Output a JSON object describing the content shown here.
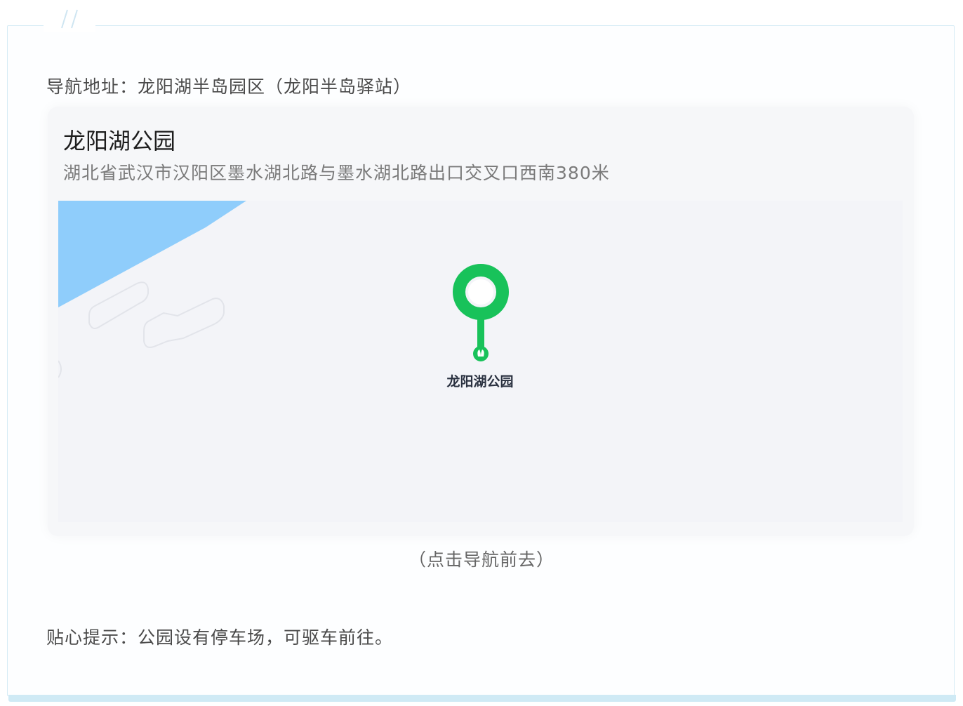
{
  "article": {
    "nav_address": "导航地址：龙阳湖半岛园区（龙阳半岛驿站）",
    "tip": "贴心提示：公园设有停车场，可驱车前往。"
  },
  "map_card": {
    "place_name": "龙阳湖公园",
    "place_address": "湖北省武汉市汉阳区墨水湖北路与墨水湖北路出口交叉口西南380米",
    "poi_label": "龙阳湖公园",
    "nav_hint": "（点击导航前去）"
  },
  "colors": {
    "frame_border": "#d6ecf5",
    "water": "#8fcdfb",
    "pin_green": "#18c25a",
    "map_bg": "#f3f4f8"
  },
  "icons": {
    "decoration": "double-slash-icon",
    "location": "map-pin-icon"
  }
}
